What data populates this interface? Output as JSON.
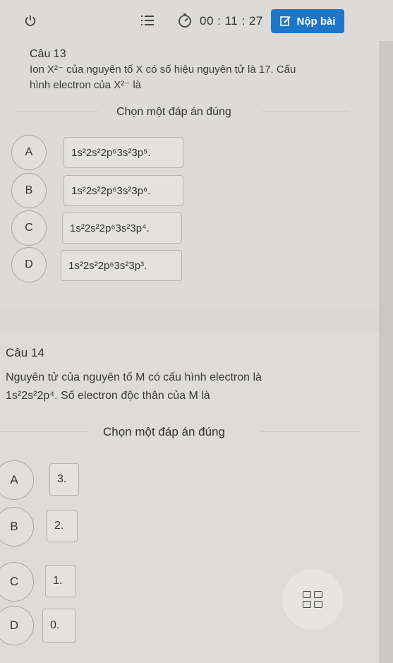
{
  "header": {
    "timer": "00 : 11 : 27",
    "submit_label": "Nộp bài",
    "icons": [
      "power-icon",
      "list-icon",
      "timer-icon",
      "edit-icon"
    ]
  },
  "q13": {
    "title": "Câu 13",
    "text_line1": "Ion X²⁻ của nguyên tố X có số hiệu nguyên tử là 17. Cấu",
    "text_line2": "hình electron của X²⁻ là",
    "choose": "Chọn một đáp án đúng",
    "options": [
      {
        "letter": "A",
        "config": "1s²2s²2p⁶3s²3p⁵."
      },
      {
        "letter": "B",
        "config": "1s²2s²2p⁶3s²3p⁶."
      },
      {
        "letter": "C",
        "config": "1s²2s²2p⁶3s²3p⁴."
      },
      {
        "letter": "D",
        "config": "1s²2s²2p⁶3s²3p³."
      }
    ]
  },
  "q14": {
    "title": "Câu 14",
    "text_line1": "Nguyên tử của nguyên tố M có cấu hình electron là",
    "text_line2": "1s²2s²2p⁴. Số electron độc thân của M là",
    "choose": "Chọn một đáp án đúng",
    "options": [
      {
        "letter": "A",
        "value": "3."
      },
      {
        "letter": "B",
        "value": "2."
      },
      {
        "letter": "C",
        "value": "1."
      },
      {
        "letter": "D",
        "value": "0."
      }
    ]
  },
  "colors": {
    "accent": "#1f75c8",
    "background": "#dcdbd7"
  }
}
